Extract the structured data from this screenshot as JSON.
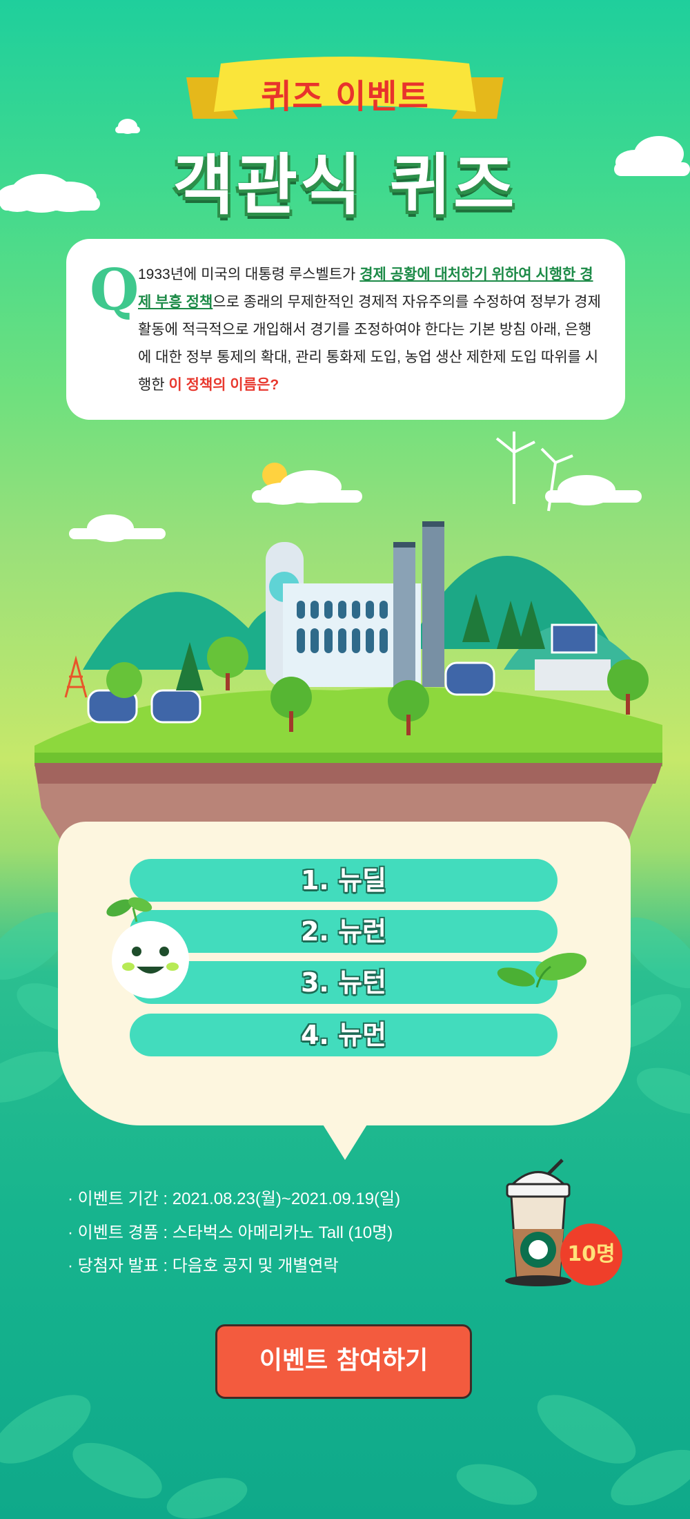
{
  "header": {
    "ribbon_label": "퀴즈 이벤트",
    "title": "객관식 퀴즈"
  },
  "question": {
    "marker": "Q",
    "text_1": "1933년에 미국의 대통령 루스벨트가 ",
    "highlight_1": "경제 공황에 대처하기 위하여 시행한 경제 부흥 정책",
    "text_2": "으로 종래의 무제한적인 경제적 자유주의를 수정하여 정부가 경제 활동에 적극적으로 개입해서 경기를 조정하여야 한다는 기본 방침 아래, 은행에 대한 정부 통제의 확대, 관리 통화제 도입, 농업 생산 제한제 도입 따위를 시행한 ",
    "highlight_2": "이 정책의 이름은?"
  },
  "options": [
    {
      "label": "1. 뉴딜"
    },
    {
      "label": "2. 뉴런"
    },
    {
      "label": "3. 뉴턴"
    },
    {
      "label": "4. 뉴먼"
    }
  ],
  "event_info": {
    "period": "· 이벤트 기간 : 2021.08.23(월)~2021.09.19(일)",
    "prize": "· 이벤트 경품 : 스타벅스 아메리카노 Tall (10명)",
    "announcement": "· 당첨자 발표 : 다음호 공지 및 개별연락"
  },
  "prize_badge": "10명",
  "cta_label": "이벤트 참여하기",
  "colors": {
    "accent_green": "#3ec88d",
    "option_bg": "#42dcbd",
    "cta": "#f35b3e",
    "highlight_red": "#e8392f",
    "highlight_green": "#1c8a47"
  }
}
